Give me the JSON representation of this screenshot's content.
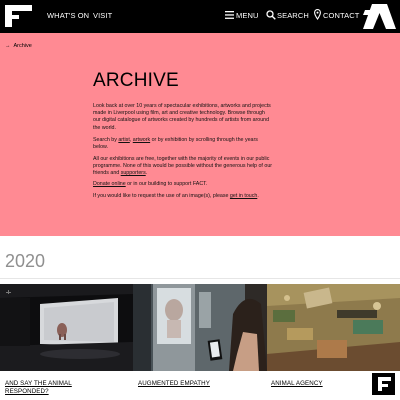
{
  "header": {
    "nav": {
      "whats_on": "WHAT'S ON",
      "visit": "VISIT",
      "menu": "MENU",
      "search": "SEARCH",
      "contact": "CONTACT"
    }
  },
  "breadcrumb": {
    "arrow": "→",
    "label": "Archive"
  },
  "archive": {
    "title": "ARCHIVE",
    "intro": "Look back at over 10 years of spectacular exhibitions, artworks and projects made in Liverpool using film, art and creative technology. Browse through our digital catalogue of artworks created by hundreds of artists from around the world.",
    "search_prefix": "Search by ",
    "search_artist": "artist",
    "search_comma": ", ",
    "search_artwork": "artwork",
    "search_suffix": " or by exhibition by scrolling through the years below.",
    "free_prefix": "All our exhibitions are free, together with the majority of events in our public programme. None of this would be possible without the generous help of our friends and ",
    "free_supporters": "supporters",
    "free_suffix": ".",
    "donate_link": "Donate online",
    "donate_suffix": " or in our building to support FACT.",
    "request_prefix": "If you would like to request the use of an image(s), please ",
    "request_link": "get in touch",
    "request_suffix": "."
  },
  "year": "2020",
  "cards": [
    {
      "title": "AND SAY THE ANIMAL RESPONDED?"
    },
    {
      "title": "AUGMENTED EMPATHY"
    },
    {
      "title": "ANIMAL AGENCY"
    }
  ],
  "colors": {
    "header_bg": "#000000",
    "archive_bg": "#ff8a93",
    "year_text": "#8f8f8f"
  }
}
